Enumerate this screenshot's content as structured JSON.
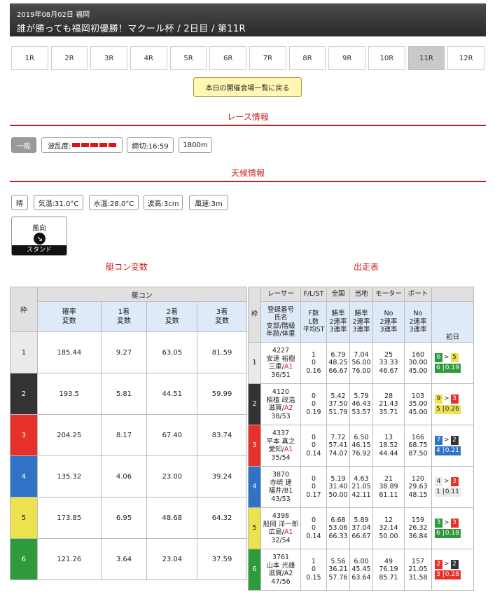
{
  "header": {
    "date_place": "2019年08月02日 福岡",
    "title": "誰が勝っても福岡初優勝！マクール杯 / 2日目 / 第11R"
  },
  "tabs": [
    "1R",
    "2R",
    "3R",
    "4R",
    "5R",
    "6R",
    "7R",
    "8R",
    "9R",
    "10R",
    "11R",
    "12R"
  ],
  "active_tab": "11R",
  "back_button": "本日の開催会場一覧に戻る",
  "race_info": {
    "title": "レース情報",
    "grade": "一般",
    "wave_label": "波乱度:",
    "deadline": "締切:16:59",
    "distance": "1800m"
  },
  "weather": {
    "title": "天候情報",
    "sky": "晴",
    "air_temp": "気温:31.0°C",
    "water_temp": "水温:28.0°C",
    "wave_height": "波高:3cm",
    "wind_speed": "風速:3m",
    "wind_dir_label": "風向",
    "stand": "スタンド"
  },
  "left_title": "艇コン変数",
  "right_title": "出走表",
  "boatcon": {
    "waku": "枠",
    "group": "艇コン",
    "c_rate": "確率\n変数",
    "c_1": "1着\n変数",
    "c_2": "2着\n変数",
    "c_3": "3着\n変数",
    "rows": [
      {
        "waku": "1",
        "rate": "185.44",
        "f1": "9.27",
        "f2": "63.05",
        "f3": "81.59"
      },
      {
        "waku": "2",
        "rate": "193.5",
        "f1": "5.81",
        "f2": "44.51",
        "f3": "59.99"
      },
      {
        "waku": "3",
        "rate": "204.25",
        "f1": "8.17",
        "f2": "67.40",
        "f3": "83.74"
      },
      {
        "waku": "4",
        "rate": "135.32",
        "f1": "4.06",
        "f2": "23.00",
        "f3": "39.24"
      },
      {
        "waku": "5",
        "rate": "173.85",
        "f1": "6.95",
        "f2": "48.68",
        "f3": "64.32"
      },
      {
        "waku": "6",
        "rate": "121.26",
        "f1": "3.64",
        "f2": "23.04",
        "f3": "37.59"
      }
    ]
  },
  "entries": {
    "h_waku": "枠",
    "h_racer": "レーサー",
    "h_flst": "F/L/ST",
    "h_zenkoku": "全国",
    "h_touchi": "当地",
    "h_motor": "モーター",
    "h_boat": "ボート",
    "h_first": "初日",
    "s_racer": "登録番号\n氏名\n支部/階級\n年齢/体重",
    "s_flst": "F数\nL数\n平均ST",
    "s_rate": "勝率\n2連率\n3連率",
    "s_mb": "No\n2連率\n3連率",
    "rows": [
      {
        "waku": "1",
        "id": "4227",
        "name": "安達 裕樹",
        "branch": "三重/",
        "cls": "A1",
        "age": "36/51",
        "f": "1",
        "l": "0",
        "st": "0.16",
        "z": [
          "6.79",
          "48.25",
          "66.67"
        ],
        "t": [
          "7.04",
          "56.00",
          "76.00"
        ],
        "m": [
          "25",
          "33.33",
          "46.67"
        ],
        "b": [
          "160",
          "30.00",
          "45.00"
        ],
        "d1": [
          "6",
          ">",
          "5"
        ],
        "d1c": [
          "w6",
          "w5"
        ],
        "d2": [
          "6",
          "0.19"
        ],
        "d2c": "w6"
      },
      {
        "waku": "2",
        "id": "4120",
        "name": "栢植 政浩",
        "branch": "滋賀/",
        "cls": "A2",
        "age": "38/53",
        "f": "0",
        "l": "0",
        "st": "0.19",
        "z": [
          "5.42",
          "37.50",
          "51.79"
        ],
        "t": [
          "5.79",
          "46.43",
          "53.57"
        ],
        "m": [
          "28",
          "21.43",
          "35.71"
        ],
        "b": [
          "103",
          "35.00",
          "45.00"
        ],
        "d1": [
          "9",
          ">",
          "3"
        ],
        "d1c": [
          "w5",
          "w3"
        ],
        "d2": [
          "5",
          "0.26"
        ],
        "d2c": "w5"
      },
      {
        "waku": "3",
        "id": "4337",
        "name": "平本 真之",
        "branch": "愛知/",
        "cls": "A1",
        "age": "35/54",
        "f": "0",
        "l": "0",
        "st": "0.14",
        "z": [
          "7.72",
          "57.41",
          "74.07"
        ],
        "t": [
          "6.50",
          "46.15",
          "76.92"
        ],
        "m": [
          "13",
          "18.52",
          "44.44"
        ],
        "b": [
          "166",
          "68.75",
          "87.50"
        ],
        "d1": [
          "7",
          ">",
          "2"
        ],
        "d1c": [
          "w4",
          "w2"
        ],
        "d2": [
          "4",
          "0.21"
        ],
        "d2c": "w4"
      },
      {
        "waku": "4",
        "id": "3870",
        "name": "寺崎 建",
        "branch": "福井/B1",
        "cls": "",
        "age": "43/53",
        "f": "0",
        "l": "0",
        "st": "0.17",
        "z": [
          "5.19",
          "31.40",
          "50.00"
        ],
        "t": [
          "4.63",
          "21.05",
          "42.11"
        ],
        "m": [
          "21",
          "38.89",
          "61.11"
        ],
        "b": [
          "120",
          "29.63",
          "48.15"
        ],
        "d1": [
          "4",
          ">",
          "3"
        ],
        "d1c": [
          "w1",
          "w3"
        ],
        "d2": [
          "1",
          "0.11"
        ],
        "d2c": "w1"
      },
      {
        "waku": "5",
        "id": "4398",
        "name": "船岡 洋一郎",
        "branch": "広島/",
        "cls": "A1",
        "age": "32/54",
        "f": "0",
        "l": "0",
        "st": "0.14",
        "z": [
          "6.68",
          "53.06",
          "66.33"
        ],
        "t": [
          "5.89",
          "37.04",
          "66.67"
        ],
        "m": [
          "12",
          "32.14",
          "50.00"
        ],
        "b": [
          "159",
          "26.32",
          "36.84"
        ],
        "d1": [
          "3",
          ">",
          "3"
        ],
        "d1c": [
          "w6",
          "w3"
        ],
        "d2": [
          "6",
          "0.18"
        ],
        "d2c": "w6"
      },
      {
        "waku": "6",
        "id": "3761",
        "name": "山本 光雄",
        "branch": "滋賀/A2",
        "cls": "",
        "age": "47/56",
        "f": "1",
        "l": "0",
        "st": "0.15",
        "z": [
          "5.56",
          "36.21",
          "57.76"
        ],
        "t": [
          "6.00",
          "45.45",
          "63.64"
        ],
        "m": [
          "49",
          "76.19",
          "85.71"
        ],
        "b": [
          "157",
          "21.05",
          "31.58"
        ],
        "d1": [
          "2",
          ">",
          "2"
        ],
        "d1c": [
          "w3",
          "w2"
        ],
        "d2": [
          "3",
          "0.28"
        ],
        "d2c": "w3"
      }
    ]
  }
}
